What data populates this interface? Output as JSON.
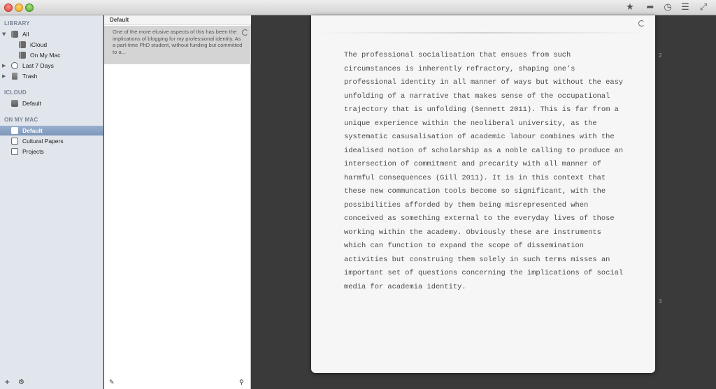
{
  "toolbar": {
    "icons": [
      "star-icon",
      "share-icon",
      "history-icon",
      "list-icon",
      "fullscreen-icon"
    ]
  },
  "sidebar": {
    "library_header": "LIBRARY",
    "library_items": [
      {
        "label": "All",
        "icon": "library-icon"
      },
      {
        "label": "iCloud",
        "icon": "book-icon"
      },
      {
        "label": "On My Mac",
        "icon": "book-icon"
      },
      {
        "label": "Last 7 Days",
        "icon": "clock-icon"
      },
      {
        "label": "Trash",
        "icon": "trash-icon"
      }
    ],
    "icloud_header": "ICLOUD",
    "icloud_items": [
      {
        "label": "Default",
        "icon": "box-icon"
      }
    ],
    "mac_header": "ON MY MAC",
    "mac_items": [
      {
        "label": "Default",
        "icon": "box-icon",
        "selected": true
      },
      {
        "label": "Cultural Papers",
        "icon": "papers-icon"
      },
      {
        "label": "Projects",
        "icon": "papers-icon"
      }
    ],
    "footer": {
      "add": "+",
      "gear": "⚙"
    }
  },
  "notelist": {
    "header": "Default",
    "notes": [
      {
        "preview": "One of the more elusive aspects of this has been the implications of blogging for my professional identity. As a part-time PhD student, without funding but committed to a..."
      }
    ]
  },
  "document": {
    "body": "The professional socialisation that ensues from such circumstances is inherently refractory, shaping one’s professional identity in all manner of ways but without the easy unfolding of a narrative that makes sense of the occupational trajectory that is unfolding (Sennett 2011). This is far from a unique experience within the neoliberal university, as the systematic casusalisation of academic labour combines with the idealised notion of scholarship as a noble calling to produce an intersection of commitment and precarity with all manner of harmful consequences (Gill 2011). It is in this context that these new communcation tools become so significant, with the possibilities afforded by them being misrepresented when conceived as something external to the everyday lives of those working within the academy. Obviously these are instruments which can function to expand the scope of dissemination activities but construing them solely in such terms misses an important set of questions concerning the implications of social media for academia identity.",
    "lines": [
      "The professional socialisation that ensues from such",
      "circumstances is inherently refractory, shaping one’s",
      "professional identity in all manner of ways but without the easy",
      "unfolding of a narrative that makes sense of the occupational",
      "trajectory that is unfolding (Sennett 2011). This is far from a",
      "unique experience within the neoliberal university, as the",
      "systematic casusalisation of academic labour combines with the",
      "idealised notion of scholarship as a noble calling to produce an",
      "intersection of commitment and precarity with all manner of",
      "harmful consequences (Gill 2011). It is in this context that",
      "these new communcation tools become so significant, with the",
      "possibilities afforded by them being misrepresented when",
      "conceived as something external to the everyday lives of those",
      "working within the academy. Obviously these are instruments",
      "which can function to expand the scope of dissemination",
      "activities but construing them solely in such terms misses an",
      "important set of questions concerning the implications of social",
      "media for academia identity."
    ],
    "page_numbers": [
      "2",
      "3"
    ]
  }
}
